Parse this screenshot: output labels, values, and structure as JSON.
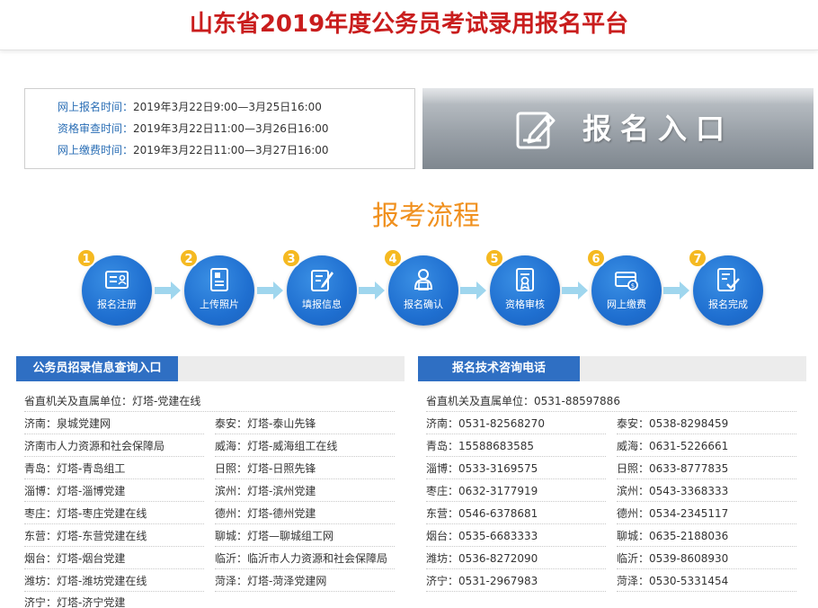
{
  "header": {
    "title": "山东省2019年度公务员考试录用报名平台"
  },
  "schedule": [
    {
      "label": "网上报名时间：",
      "value": "2019年3月22日9:00—3月25日16:00"
    },
    {
      "label": "资格审查时间：",
      "value": "2019年3月22日11:00—3月26日16:00"
    },
    {
      "label": "网上缴费时间：",
      "value": "2019年3月22日11:00—3月27日16:00"
    }
  ],
  "entry": {
    "label": "报名入口",
    "icon": "edit-document-icon"
  },
  "process": {
    "title": "报考流程",
    "steps": [
      {
        "num": "1",
        "label": "报名注册",
        "icon": "id-card-icon"
      },
      {
        "num": "2",
        "label": "上传照片",
        "icon": "photo-document-icon"
      },
      {
        "num": "3",
        "label": "填报信息",
        "icon": "form-edit-icon"
      },
      {
        "num": "4",
        "label": "报名确认",
        "icon": "user-confirm-icon"
      },
      {
        "num": "5",
        "label": "资格审核",
        "icon": "certificate-icon"
      },
      {
        "num": "6",
        "label": "网上缴费",
        "icon": "payment-card-icon"
      },
      {
        "num": "7",
        "label": "报名完成",
        "icon": "check-document-icon"
      }
    ]
  },
  "query_panel": {
    "title": "公务员招录信息查询入口",
    "items": [
      "省直机关及直属单位：灯塔-党建在线",
      "济南：泉城党建网",
      "泰安：灯塔-泰山先锋",
      "济南市人力资源和社会保障局",
      "威海：灯塔-威海组工在线",
      "青岛：灯塔-青岛组工",
      "日照：灯塔-日照先锋",
      "淄博：灯塔-淄博党建",
      "滨州：灯塔-滨州党建",
      "枣庄：灯塔-枣庄党建在线",
      "德州：灯塔-德州党建",
      "东营：灯塔-东营党建在线",
      "聊城：灯塔—聊城组工网",
      "烟台：灯塔-烟台党建",
      "临沂：临沂市人力资源和社会保障局",
      "潍坊：灯塔-潍坊党建在线",
      "菏泽：灯塔-菏泽党建网",
      "济宁：灯塔-济宁党建"
    ]
  },
  "phone_panel": {
    "title": "报名技术咨询电话",
    "items": [
      "省直机关及直属单位：0531-88597886",
      "济南：0531-82568270",
      "泰安：0538-8298459",
      "青岛：15588683585",
      "威海：0631-5226661",
      "淄博：0533-3169575",
      "日照：0633-8777835",
      "枣庄：0632-3177919",
      "滨州：0543-3368333",
      "东营：0546-6378681",
      "德州：0534-2345117",
      "烟台：0535-6683333",
      "聊城：0635-2188036",
      "潍坊：0536-8272090",
      "临沂：0539-8608930",
      "济宁：0531-2967983",
      "菏泽：0530-5331454"
    ]
  },
  "colors": {
    "title_red": "#c91d1d",
    "link_blue": "#2a6eb5",
    "tab_blue": "#2f6fc3",
    "flow_orange": "#f0901e",
    "badge_yellow": "#f5b921",
    "step_blue": "#1f6fd0"
  }
}
